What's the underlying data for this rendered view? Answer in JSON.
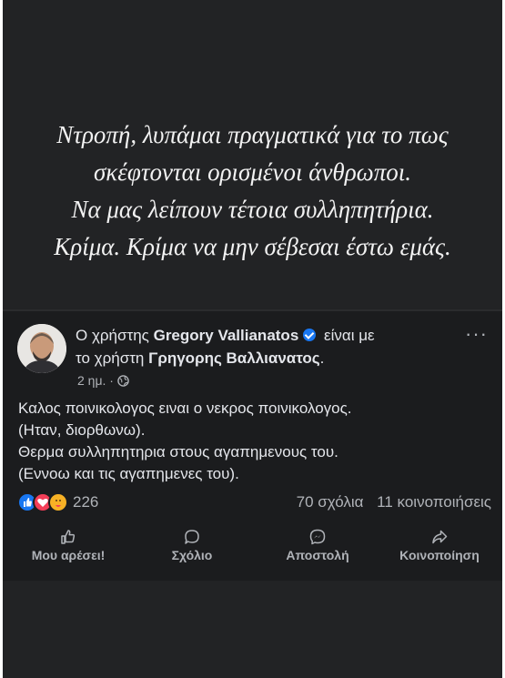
{
  "quote": {
    "lines": [
      "Ντροπή, λυπάμαι πραγματικά για το πως",
      "σκέφτονται ορισμένοι άνθρωποι.",
      "Να μας λείπουν τέτοια συλληπητήρια.",
      "Κρίμα. Κρίμα να μην σέβεσαι έστω εμάς."
    ]
  },
  "post": {
    "prefix": "Ο χρήστης",
    "author": "Gregory Vallianatos",
    "with_text": "είναι με",
    "line2_prefix": "το χρήστη",
    "tagged": "Γρηγορης Βαλλιανατος",
    "line2_suffix": ".",
    "time": "2 ημ. ·",
    "more": "···",
    "body": [
      "Καλος ποινικολογος ειναι ο νεκρος ποινικολογος.",
      "(Ηταν, διορθωνω).",
      "Θερμα συλληπητηρια στους αγαπημενους του.",
      "(Εννοω και τις αγαπημενες του)."
    ],
    "reaction_count": "226",
    "comments": "70 σχόλια",
    "shares": "11 κοινοποιήσεις",
    "colors": {
      "like": "#1877f2",
      "love": "#f33e58",
      "care": "#f7b125"
    }
  },
  "actions": {
    "like": "Μου αρέσει!",
    "comment": "Σχόλιο",
    "send": "Αποστολή",
    "share": "Κοινοποίηση"
  }
}
